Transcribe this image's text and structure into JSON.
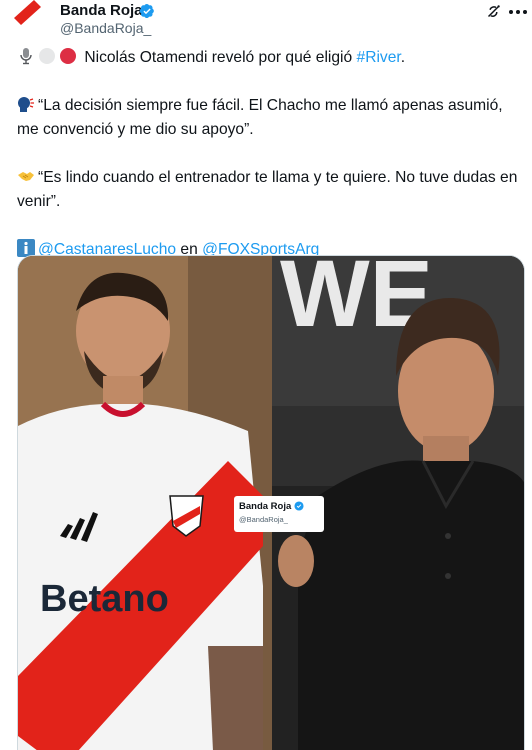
{
  "account": {
    "name": "Banda Roja",
    "handle": "@BandaRoja_",
    "verified": true,
    "avatar_icon": "red-slash-logo-icon"
  },
  "header_icons": [
    "grok-icon",
    "more-options-icon"
  ],
  "tweet": {
    "line1_text": "Nicolás Otamendi reveló por qué eligió",
    "line1_hashtag": "#River",
    "line1_end": ".",
    "quote1_line1": "“La decisión siempre fue fácil. El Chacho me llamó apenas asumió,",
    "quote1_line2": "me convenció y me dio su apoyo”.",
    "quote2_line1": "“Es lindo cuando el entrenador te llama y te quiere. No tuve dudas en",
    "quote2_line2": "venir”.",
    "credit_mention1": "@CastanaresLucho",
    "credit_connector": "en",
    "credit_mention2": "@FOXSportsArg"
  },
  "media": {
    "sponsor": "Betano",
    "watermark_name": "Banda Roja",
    "watermark_handle": "@BandaRoja_",
    "background_letters": "WE"
  },
  "colors": {
    "link": "#1d9bf0",
    "verified": "#1d9bf0",
    "brand_red": "#e2231a"
  }
}
